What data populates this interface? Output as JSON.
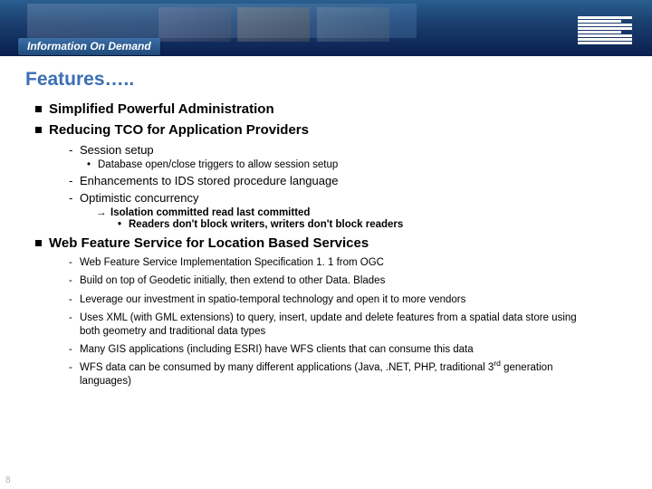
{
  "banner": {
    "badge": "Information On Demand",
    "logo": "IBM"
  },
  "title": "Features…..",
  "sections": [
    {
      "text": "Simplified Powerful Administration"
    },
    {
      "text": "Reducing TCO for Application Providers"
    }
  ],
  "tco": {
    "item1": "Session setup",
    "item1_sub": "Database open/close triggers to allow session setup",
    "item2": "Enhancements to IDS stored procedure language",
    "item3": "Optimistic concurrency",
    "item3_arrow": "Isolation committed read last committed",
    "item3_bullet": "Readers don't block writers, writers don't block readers"
  },
  "wfs": {
    "heading": "Web Feature Service for Location Based Services",
    "items": [
      "Web Feature Service Implementation Specification 1. 1 from OGC",
      "Build on top of Geodetic initially, then extend to other Data. Blades",
      "Leverage our investment in spatio-temporal technology and open it to more vendors",
      "Uses XML (with GML extensions) to query, insert, update and delete features from a spatial data store using both geometry and traditional data types",
      "Many GIS applications (including ESRI) have WFS clients that can consume this data",
      "WFS data can be consumed by many different applications (Java, .NET, PHP, traditional 3rd generation languages)"
    ]
  },
  "page_number": "8",
  "chart_data": {
    "type": "table",
    "title": "Features…..",
    "rows": [
      [
        "Simplified Powerful Administration"
      ],
      [
        "Reducing TCO for Application Providers"
      ],
      [
        "  Session setup"
      ],
      [
        "    Database open/close triggers to allow session setup"
      ],
      [
        "  Enhancements to IDS stored procedure language"
      ],
      [
        "  Optimistic concurrency"
      ],
      [
        "    Isolation committed read last committed"
      ],
      [
        "    Readers don't block writers, writers don't block readers"
      ],
      [
        "Web Feature Service for Location Based Services"
      ],
      [
        "  Web Feature Service Implementation Specification 1.1 from OGC"
      ],
      [
        "  Build on top of Geodetic initially, then extend to other DataBlades"
      ],
      [
        "  Leverage our investment in spatio-temporal technology and open it to more vendors"
      ],
      [
        "  Uses XML (with GML extensions) to query, insert, update and delete features from a spatial data store using both geometry and traditional data types"
      ],
      [
        "  Many GIS applications (including ESRI) have WFS clients that can consume this data"
      ],
      [
        "  WFS data can be consumed by many different applications (Java, .NET, PHP, traditional 3rd generation languages)"
      ]
    ]
  }
}
